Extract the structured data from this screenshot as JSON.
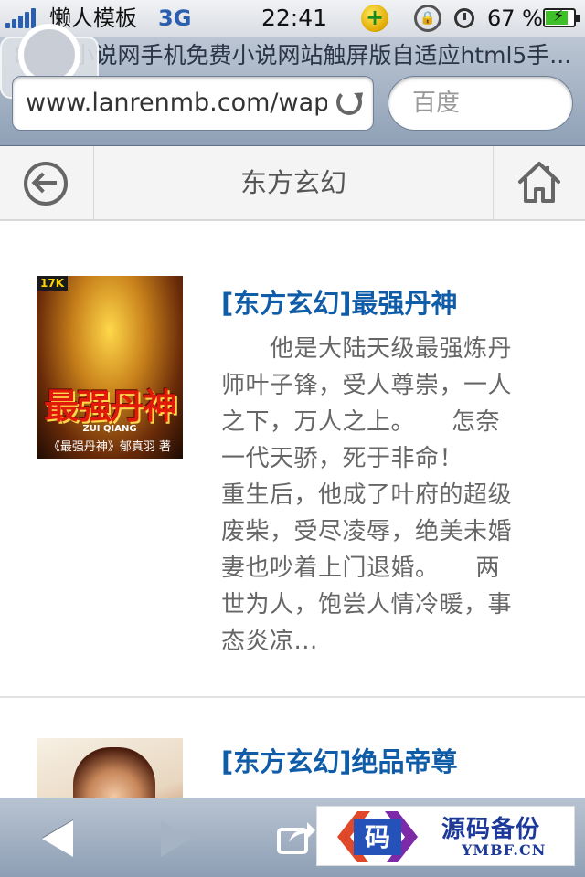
{
  "status_bar": {
    "carrier": "懒人模板",
    "network": "3G",
    "time": "22:41",
    "battery_percent": "67 %",
    "battery_level": 0.67
  },
  "browser": {
    "page_title": "8684小说网手机免费小说网站触屏版自适应html5手...",
    "url": "www.lanrenmb.com/wap",
    "search_placeholder": "百度"
  },
  "site_nav": {
    "title": "东方玄幻"
  },
  "books": [
    {
      "title": "[东方玄幻]最强丹神",
      "cover": {
        "badge": "17K",
        "title": "最强丹神",
        "pinyin": "ZUI QIANG",
        "author": "《最强丹神》郁真羽 著"
      },
      "description_lines": [
        "　　他是大陆天级最强炼丹",
        "师叶子锋，受人尊崇，一人",
        "之下，万人之上。　　怎奈",
        "一代天骄，死于非命！",
        "重生后，他成了叶府的超级",
        "废柴，受尽凌辱，绝美未婚",
        "妻也吵着上门退婚。　　两",
        "世为人，饱尝人情冷暖，事",
        "态炎凉..."
      ]
    },
    {
      "title": "[东方玄幻]绝品帝尊"
    }
  ],
  "watermark": {
    "logo_glyph": "码",
    "title": "源码备份",
    "url": "YMBF.CN"
  },
  "colors": {
    "link_blue": "#0f5ca8",
    "toolbar_top": "#b8c3d1",
    "toolbar_bottom": "#8e9fb5",
    "nav_bg": "#f4f4f4"
  },
  "icons": {
    "back": "back-circle-icon",
    "home": "home-icon",
    "reload": "reload-icon",
    "toolbar_back": "triangle-left-icon",
    "toolbar_forward": "triangle-right-icon",
    "toolbar_share": "share-icon"
  }
}
